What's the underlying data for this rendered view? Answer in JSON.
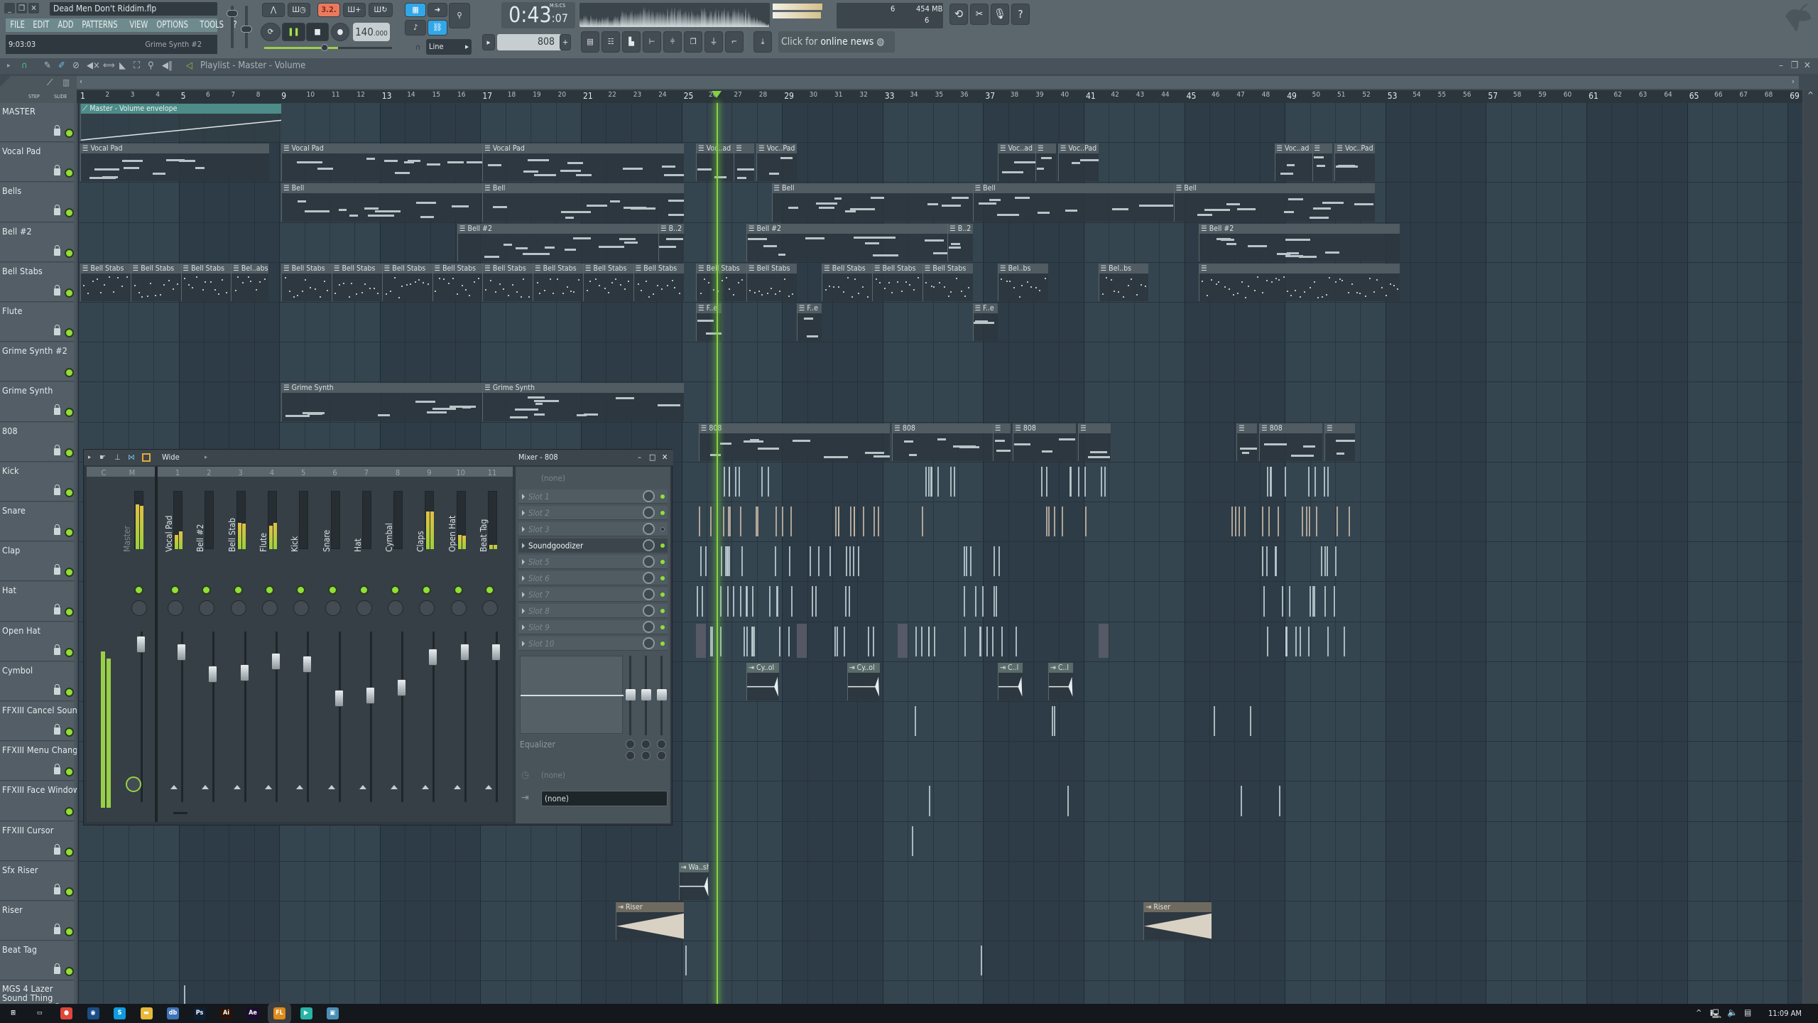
{
  "window": {
    "title": "Dead Men Don't Riddim.flp",
    "minimize": "_",
    "restore": "❐",
    "close": "✕"
  },
  "menu": [
    "FILE",
    "EDIT",
    "ADD",
    "PATTERNS",
    "VIEW",
    "OPTIONS",
    "TOOLS",
    "?"
  ],
  "hint_bar": {
    "left": "9:03:03",
    "right": "Grime Synth #2"
  },
  "transport": {
    "record_mode_label": "3.2.",
    "bpm": "140",
    "bpm_fraction": ".000",
    "time_main": "0:43",
    "time_cs": ":07",
    "time_format": "M:S:CS",
    "snap": "Line",
    "pattern": "808",
    "pattern_add": "+"
  },
  "cpu": {
    "cpu_value": "6",
    "memory": "454 MB",
    "polyphony": "6"
  },
  "news": {
    "prefix": "Click for ",
    "highlight": "online news"
  },
  "playlist": {
    "title": "Playlist - Master - Volume",
    "step_label": "STEP",
    "slide_label": "SLIDE",
    "bar_count": 69,
    "playhead_bar": 26.3,
    "tracks": [
      "MASTER",
      "Vocal Pad",
      "Bells",
      "Bell #2",
      "Bell Stabs",
      "Flute",
      "Grime Synth #2",
      "Grime Synth",
      "808",
      "Kick",
      "Snare",
      "Clap",
      "Hat",
      "Open Hat",
      "Cymbol",
      "FFXIII Cancel Sound",
      "FFXIII Menu Change",
      "FFXIII Face Window",
      "FFXIII Cursor",
      "Sfx Riser",
      "Riser",
      "Beat Tag",
      "MGS 4 Lazer Sound Thing"
    ],
    "clips": [
      {
        "track": 0,
        "start": 1,
        "len": 8,
        "label": "Master - Volume envelope",
        "kind": "auto"
      },
      {
        "track": 1,
        "start": 1,
        "len": 7.5,
        "label": "Vocal Pad"
      },
      {
        "track": 1,
        "start": 9,
        "len": 8,
        "label": "Vocal Pad"
      },
      {
        "track": 1,
        "start": 17,
        "len": 8,
        "label": "Vocal Pad"
      },
      {
        "track": 1,
        "start": 25.5,
        "len": 1.5,
        "label": "Voc..ad"
      },
      {
        "track": 1,
        "start": 27,
        "len": 0.8,
        "label": ""
      },
      {
        "track": 1,
        "start": 27.9,
        "len": 1.6,
        "label": "Voc..Pad"
      },
      {
        "track": 1,
        "start": 37.5,
        "len": 1.5,
        "label": "Voc..ad"
      },
      {
        "track": 1,
        "start": 39,
        "len": 0.8,
        "label": ""
      },
      {
        "track": 1,
        "start": 39.9,
        "len": 1.6,
        "label": "Voc..Pad"
      },
      {
        "track": 1,
        "start": 48.5,
        "len": 1.5,
        "label": "Voc..ad"
      },
      {
        "track": 1,
        "start": 50,
        "len": 0.8,
        "label": ""
      },
      {
        "track": 1,
        "start": 50.9,
        "len": 1.6,
        "label": "Voc..Pad"
      },
      {
        "track": 2,
        "start": 9,
        "len": 8,
        "label": "Bell"
      },
      {
        "track": 2,
        "start": 17,
        "len": 8,
        "label": "Bell"
      },
      {
        "track": 2,
        "start": 28.5,
        "len": 8,
        "label": "Bell"
      },
      {
        "track": 2,
        "start": 36.5,
        "len": 8,
        "label": "Bell"
      },
      {
        "track": 2,
        "start": 44.5,
        "len": 8,
        "label": "Bell"
      },
      {
        "track": 3,
        "start": 16,
        "len": 8,
        "label": "Bell #2"
      },
      {
        "track": 3,
        "start": 24,
        "len": 1,
        "label": "B..2"
      },
      {
        "track": 3,
        "start": 27.5,
        "len": 8,
        "label": "Bell #2"
      },
      {
        "track": 3,
        "start": 35.5,
        "len": 1,
        "label": "B..2"
      },
      {
        "track": 3,
        "start": 45.5,
        "len": 8,
        "label": "Bell #2"
      },
      {
        "track": 4,
        "start": 1,
        "len": 2,
        "label": "Bell Stabs"
      },
      {
        "track": 4,
        "start": 3,
        "len": 2,
        "label": "Bell Stabs"
      },
      {
        "track": 4,
        "start": 5,
        "len": 2,
        "label": "Bell Stabs"
      },
      {
        "track": 4,
        "start": 7,
        "len": 1.5,
        "label": "Bel..abs"
      },
      {
        "track": 4,
        "start": 9,
        "len": 2,
        "label": "Bell Stabs"
      },
      {
        "track": 4,
        "start": 11,
        "len": 2,
        "label": "Bell Stabs"
      },
      {
        "track": 4,
        "start": 13,
        "len": 2,
        "label": "Bell Stabs"
      },
      {
        "track": 4,
        "start": 15,
        "len": 2,
        "label": "Bell Stabs"
      },
      {
        "track": 4,
        "start": 17,
        "len": 2,
        "label": "Bell Stabs"
      },
      {
        "track": 4,
        "start": 19,
        "len": 2,
        "label": "Bell Stabs"
      },
      {
        "track": 4,
        "start": 21,
        "len": 2,
        "label": "Bell Stabs"
      },
      {
        "track": 4,
        "start": 23,
        "len": 2,
        "label": "Bell Stabs"
      },
      {
        "track": 4,
        "start": 25.5,
        "len": 2,
        "label": "Bell Stabs"
      },
      {
        "track": 4,
        "start": 27.5,
        "len": 2,
        "label": "Bell Stabs"
      },
      {
        "track": 4,
        "start": 30.5,
        "len": 2,
        "label": "Bell Stabs"
      },
      {
        "track": 4,
        "start": 32.5,
        "len": 2,
        "label": "Bell Stabs"
      },
      {
        "track": 4,
        "start": 34.5,
        "len": 2,
        "label": "Bell Stabs"
      },
      {
        "track": 4,
        "start": 37.5,
        "len": 2,
        "label": "Bel..bs"
      },
      {
        "track": 4,
        "start": 41.5,
        "len": 2,
        "label": "Bel..bs"
      },
      {
        "track": 4,
        "start": 45.5,
        "len": 8,
        "label": ""
      },
      {
        "track": 5,
        "start": 25.5,
        "len": 1,
        "label": "F..e"
      },
      {
        "track": 5,
        "start": 29.5,
        "len": 1,
        "label": "F..e"
      },
      {
        "track": 5,
        "start": 36.5,
        "len": 1,
        "label": "F..e"
      },
      {
        "track": 7,
        "start": 9,
        "len": 8,
        "label": "Grime Synth"
      },
      {
        "track": 7,
        "start": 17,
        "len": 8,
        "label": "Grime Synth"
      },
      {
        "track": 8,
        "start": 25.6,
        "len": 7.6,
        "label": "808"
      },
      {
        "track": 8,
        "start": 33.3,
        "len": 4,
        "label": "808"
      },
      {
        "track": 8,
        "start": 37.3,
        "len": 0.7,
        "label": ""
      },
      {
        "track": 8,
        "start": 38.1,
        "len": 2.5,
        "label": "808"
      },
      {
        "track": 8,
        "start": 40.7,
        "len": 1.3,
        "label": ""
      },
      {
        "track": 8,
        "start": 47,
        "len": 0.8,
        "label": ""
      },
      {
        "track": 8,
        "start": 47.9,
        "len": 2.5,
        "label": "808"
      },
      {
        "track": 8,
        "start": 50.5,
        "len": 1.2,
        "label": ""
      },
      {
        "track": 14,
        "start": 27.5,
        "len": 1.3,
        "label": "Cy..ol",
        "kind": "audio"
      },
      {
        "track": 14,
        "start": 31.5,
        "len": 1.3,
        "label": "Cy..ol",
        "kind": "audio"
      },
      {
        "track": 14,
        "start": 37.5,
        "len": 1,
        "label": "C..l",
        "kind": "audio"
      },
      {
        "track": 14,
        "start": 39.5,
        "len": 1,
        "label": "C..l",
        "kind": "audio"
      },
      {
        "track": 19,
        "start": 24.8,
        "len": 1.2,
        "label": "Wa..sh",
        "kind": "audio"
      },
      {
        "track": 20,
        "start": 22.3,
        "len": 2.7,
        "label": "Riser",
        "kind": "riser"
      },
      {
        "track": 20,
        "start": 43.3,
        "len": 2.7,
        "label": "Riser",
        "kind": "riser"
      }
    ]
  },
  "mixer": {
    "title": "Mixer - 808",
    "preset": "Wide",
    "strip_headers": [
      "C",
      "M",
      "1",
      "2",
      "3",
      "4",
      "5",
      "6",
      "7",
      "8",
      "9",
      "10",
      "11"
    ],
    "master_label": "Master",
    "tracks": [
      {
        "name": "Vocal Pad",
        "level_l": 0.24,
        "level_r": 0.3,
        "fader": 0.86
      },
      {
        "name": "Bell #2",
        "level_l": 0,
        "level_r": 0,
        "fader": 0.6
      },
      {
        "name": "Bell Stab",
        "level_l": 0.45,
        "level_r": 0.44,
        "fader": 0.62
      },
      {
        "name": "Flute",
        "level_l": 0.4,
        "level_r": 0.45,
        "fader": 0.75
      },
      {
        "name": "Kick",
        "level_l": 0,
        "level_r": 0,
        "fader": 0.72
      },
      {
        "name": "Snare",
        "level_l": 0,
        "level_r": 0,
        "fader": 0.32
      },
      {
        "name": "Hat",
        "level_l": 0,
        "level_r": 0,
        "fader": 0.35
      },
      {
        "name": "Cymbal",
        "level_l": 0,
        "level_r": 0,
        "fader": 0.44
      },
      {
        "name": "Claps",
        "level_l": 0.65,
        "level_r": 0.65,
        "fader": 0.8
      },
      {
        "name": "Open Hat",
        "level_l": 0.24,
        "level_r": 0.23,
        "fader": 0.86
      },
      {
        "name": "Beat Tag",
        "level_l": 0.07,
        "level_r": 0.07,
        "fader": 0.86
      }
    ],
    "master_level_l": 0.77,
    "master_level_r": 0.75,
    "insert_input": "(none)",
    "slots": [
      {
        "label": "Slot 1",
        "filled": false,
        "enabled": true
      },
      {
        "label": "Slot 2",
        "filled": false,
        "enabled": true
      },
      {
        "label": "Slot 3",
        "filled": false,
        "enabled": false
      },
      {
        "label": "Soundgoodizer",
        "filled": true,
        "enabled": true
      },
      {
        "label": "Slot 5",
        "filled": false,
        "enabled": true
      },
      {
        "label": "Slot 6",
        "filled": false,
        "enabled": true
      },
      {
        "label": "Slot 7",
        "filled": false,
        "enabled": true
      },
      {
        "label": "Slot 8",
        "filled": false,
        "enabled": true
      },
      {
        "label": "Slot 9",
        "filled": false,
        "enabled": true
      },
      {
        "label": "Slot 10",
        "filled": false,
        "enabled": true
      }
    ],
    "eq_label": "Equalizer",
    "latency": "(none)",
    "output": "(none)"
  },
  "taskbar": {
    "apps": [
      {
        "name": "start",
        "glyph": "⊞",
        "color": "#ffffff"
      },
      {
        "name": "task-view",
        "glyph": "▭",
        "color": "#ffffff"
      },
      {
        "name": "chrome",
        "glyph": "●",
        "color": "#e0463a"
      },
      {
        "name": "steam",
        "glyph": "◉",
        "color": "#1b4e86"
      },
      {
        "name": "skype",
        "glyph": "S",
        "color": "#0f9be0"
      },
      {
        "name": "file-explorer",
        "glyph": "▬",
        "color": "#e9b93a"
      },
      {
        "name": "app-db",
        "glyph": "db",
        "color": "#3e73b8"
      },
      {
        "name": "photoshop",
        "glyph": "Ps",
        "color": "#0b2034"
      },
      {
        "name": "illustrator",
        "glyph": "Ai",
        "color": "#2c1205"
      },
      {
        "name": "after-effects",
        "glyph": "Ae",
        "color": "#1c0c33"
      },
      {
        "name": "fl-studio",
        "glyph": "FL",
        "color": "#e08b1a"
      },
      {
        "name": "app-teal",
        "glyph": "▶",
        "color": "#26b4a6"
      },
      {
        "name": "photos",
        "glyph": "▣",
        "color": "#4a8fb8"
      }
    ],
    "clock": "11:09 AM"
  }
}
